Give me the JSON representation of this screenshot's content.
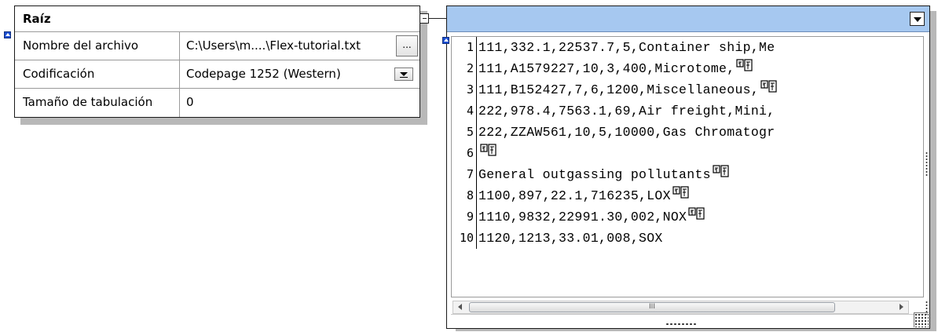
{
  "root_panel": {
    "title": "Raíz",
    "rows": [
      {
        "label": "Nombre del archivo",
        "value": "C:\\Users\\m....\\Flex-tutorial.txt",
        "control": "ellipsis",
        "control_label": "..."
      },
      {
        "label": "Codificación",
        "value": "Codepage 1252 (Western)",
        "control": "dropdown"
      },
      {
        "label": "Tamaño de tabulación",
        "value": "0",
        "control": "none"
      }
    ]
  },
  "file_panel": {
    "header_color": "#a6c8f0",
    "lines": [
      {
        "n": "1",
        "text": "111,332.1,22537.7,5,Container ship,Me",
        "crlf": false
      },
      {
        "n": "2",
        "text": "111,A1579227,10,3,400,Microtome,",
        "crlf": true
      },
      {
        "n": "3",
        "text": "111,B152427,7,6,1200,Miscellaneous,",
        "crlf": true
      },
      {
        "n": "4",
        "text": "222,978.4,7563.1,69,Air freight,Mini,",
        "crlf": false
      },
      {
        "n": "5",
        "text": "222,ZZAW561,10,5,10000,Gas Chromatogr",
        "crlf": false
      },
      {
        "n": "6",
        "text": "",
        "crlf": true
      },
      {
        "n": "7",
        "text": "General outgassing pollutants",
        "crlf": true
      },
      {
        "n": "8",
        "text": "1100,897,22.1,716235,LOX",
        "crlf": true
      },
      {
        "n": "9",
        "text": "1110,9832,22991.30,002,NOX",
        "crlf": true
      },
      {
        "n": "10",
        "text": "1120,1213,33.01,008,SOX",
        "crlf": false
      }
    ],
    "scroll_thumb_label": "III"
  }
}
